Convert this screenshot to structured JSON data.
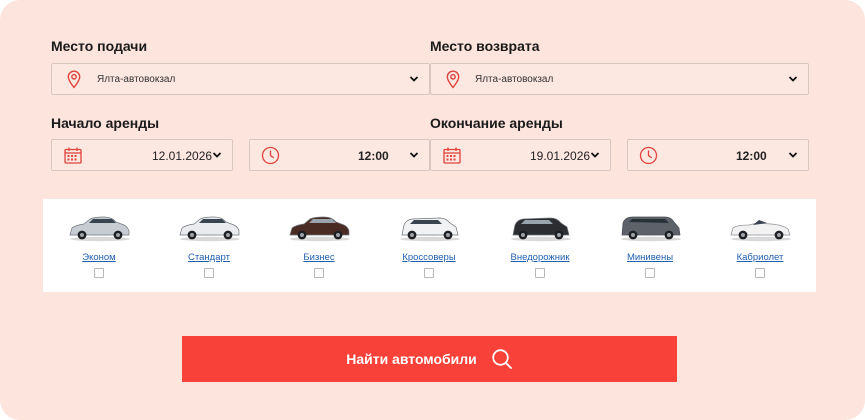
{
  "pickup": {
    "label": "Место подачи",
    "value": "Ялта-автовокзал"
  },
  "dropoff": {
    "label": "Место возврата",
    "value": "Ялта-автовокзал"
  },
  "rental_start": {
    "label": "Начало аренды",
    "date": "12.01.2026",
    "time": "12:00"
  },
  "rental_end": {
    "label": "Окончание аренды",
    "date": "19.01.2026",
    "time": "12:00"
  },
  "car_classes": [
    {
      "label": "Эконом",
      "color": "#c7ccd2",
      "checked": false
    },
    {
      "label": "Стандарт",
      "color": "#e9ebee",
      "checked": false
    },
    {
      "label": "Бизнес",
      "color": "#4a2c24",
      "checked": false
    },
    {
      "label": "Кроссоверы",
      "color": "#f1f2f3",
      "checked": false
    },
    {
      "label": "Внедорожник",
      "color": "#2b2d31",
      "checked": false
    },
    {
      "label": "Минивены",
      "color": "#5d6169",
      "checked": false
    },
    {
      "label": "Кабриолет",
      "color": "#f2f2f2",
      "checked": false
    }
  ],
  "search_button": {
    "label": "Найти автомобили"
  },
  "colors": {
    "accent": "#f84138",
    "panel_bg": "#fde4dd",
    "icon": "#e0433c",
    "link": "#1f5fb0"
  },
  "icons": {
    "location": "map-pin-icon",
    "calendar": "calendar-icon",
    "clock": "clock-icon",
    "dropdown": "chevron-down-icon",
    "search": "magnifier-icon"
  }
}
